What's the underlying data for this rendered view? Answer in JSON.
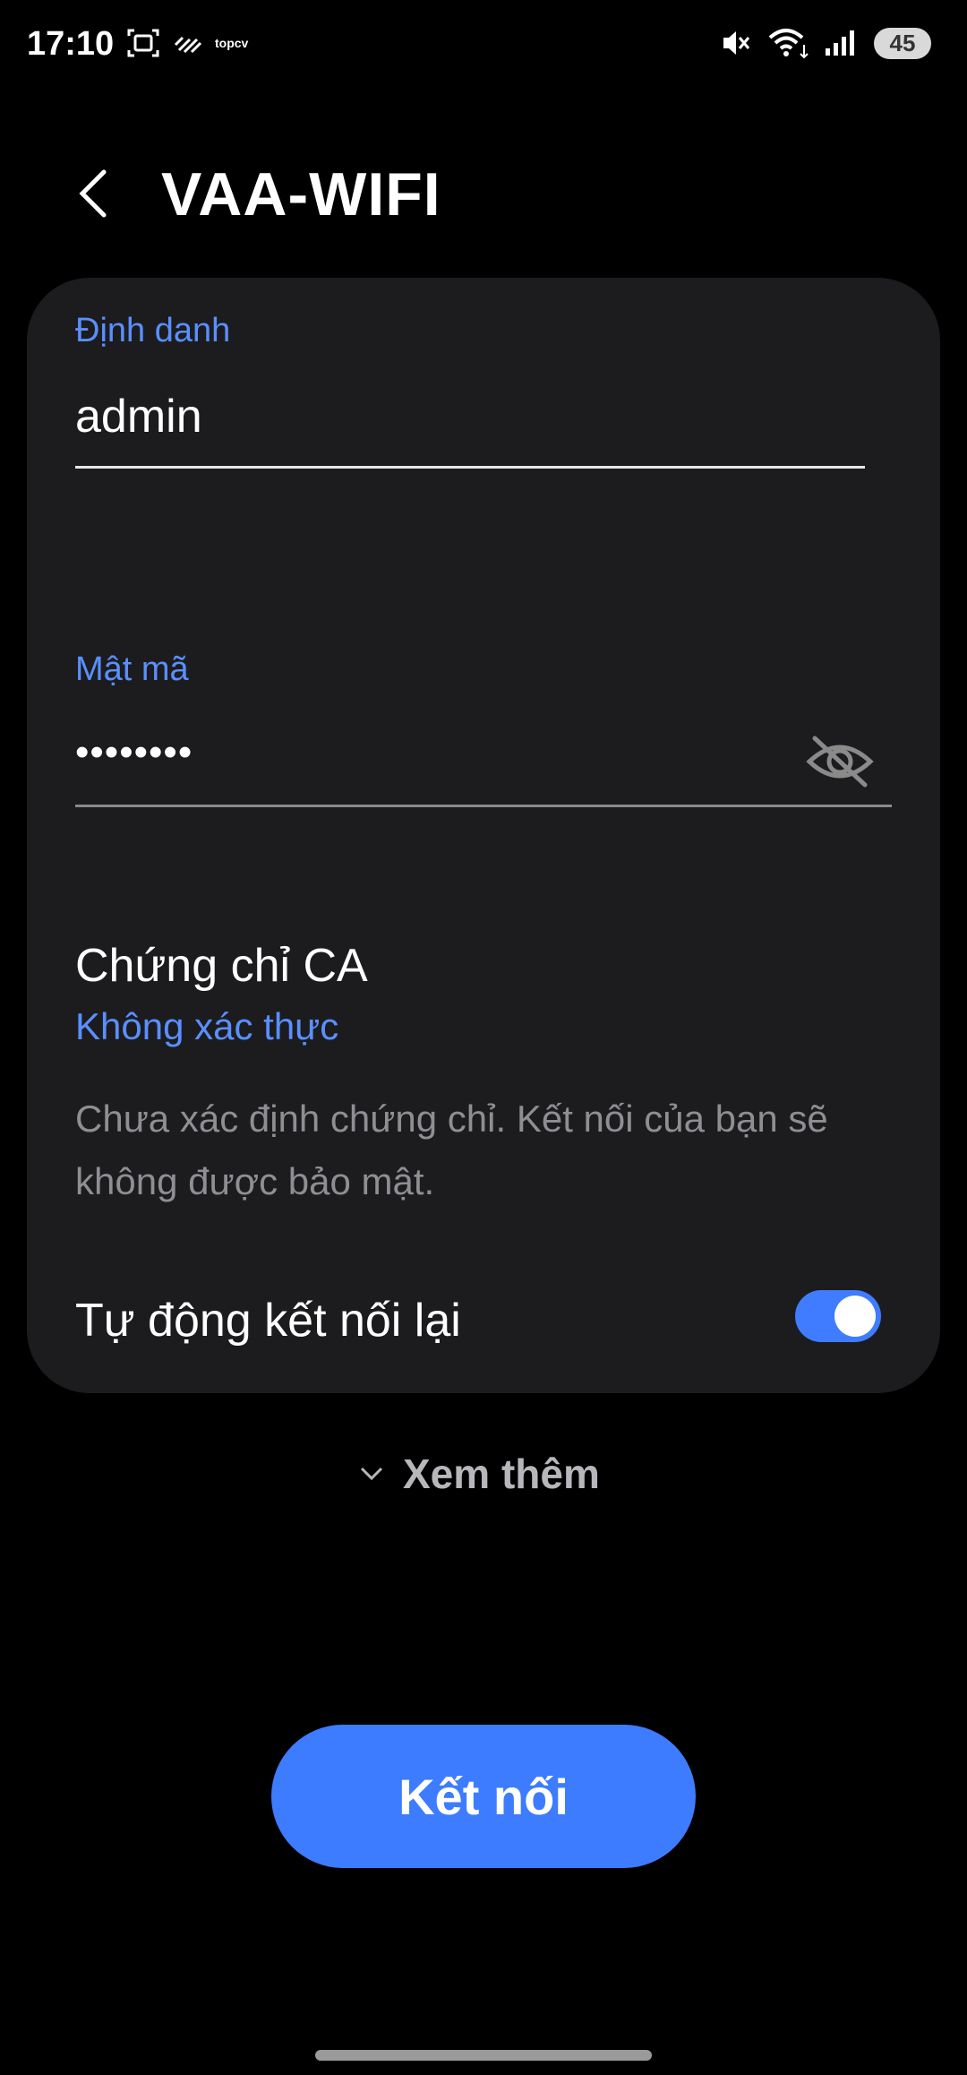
{
  "status_bar": {
    "time": "17:10",
    "small_label": "topcv",
    "battery": "45",
    "icons": [
      "screenshot-icon",
      "pattern-icon",
      "mute-icon",
      "wifi-icon",
      "signal-icon",
      "battery-icon"
    ]
  },
  "header": {
    "title": "VAA-WIFI",
    "back_icon": "chevron-left-icon"
  },
  "form": {
    "identity_label": "Định danh",
    "identity_value": "admin",
    "password_label": "Mật mã",
    "password_value": "••••••••",
    "password_toggle_icon": "eye-off-icon",
    "ca_title": "Chứng chỉ CA",
    "ca_value": "Không xác thực",
    "ca_note": "Chưa xác định chứng chỉ. Kết nối của bạn sẽ không được bảo mật.",
    "auto_reconnect_label": "Tự động kết nối lại",
    "auto_reconnect_on": true
  },
  "more": {
    "label": "Xem thêm",
    "icon": "chevron-down-icon"
  },
  "actions": {
    "connect_label": "Kết nối"
  },
  "colors": {
    "accent": "#3d7cff",
    "label_blue": "#5a8fff",
    "card_bg": "#1c1c1e",
    "muted_text": "#8e8e93"
  }
}
